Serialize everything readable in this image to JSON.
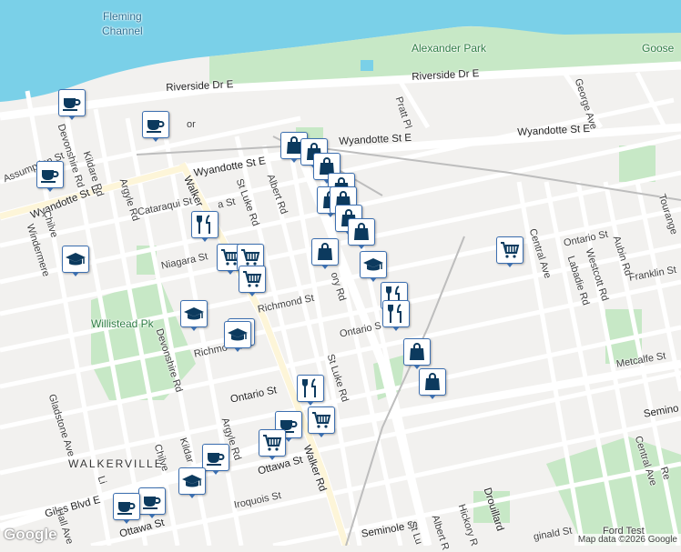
{
  "map": {
    "water_label": "Fleming\nChannel",
    "park_labels": {
      "alexander_park": "Alexander Park",
      "goose": "Goose",
      "willistead_pk": "Willistead Pk"
    },
    "area_label": "WALKERVILLE",
    "roads": {
      "riverside": "Riverside Dr E",
      "wyandotte_e1": "Wyandotte St E",
      "wyandotte_e2": "Wyandotte St E",
      "wyandotte_e3": "Wyandotte St E",
      "assumption": "Assumption St",
      "devonshire_top": "Devonshire Rd",
      "kildare_top": "Kildare Rd",
      "argyle_top": "Argyle Rd",
      "cataraqui": "Cataraqui St",
      "walker_top": "Walker",
      "lincoln_top": "a St",
      "st_luke_top": "St Luke Rd",
      "albert_top": "Albert Rd",
      "pratt": "Pratt Pl",
      "george": "George Ave",
      "franklin": "Franklin St",
      "ontario_right": "Ontario St",
      "westcott": "Westcott Rd",
      "aubin": "Aubin Rd",
      "labadie": "Labadie Rd",
      "central": "Central Ave",
      "central_low": "Central Ave",
      "tourangeau": "Tourange",
      "niagara": "Niagara St",
      "richmond": "Richmond St",
      "richmond_left": "Richmo",
      "devonshire_mid": "Devonshire Rd",
      "chilver_top": "Chilve",
      "windermere": "Windermere",
      "hickory_top": "ory Rd",
      "ontario_mid": "Ontario S",
      "metcalfe": "Metcalfe St",
      "st_luke_mid": "St Luke Rd",
      "ontario_low": "Ontario St",
      "gladstone": "Gladstone Ave",
      "argyle_low": "Argyle Rd",
      "kildare_low": "Kildar",
      "chilver_low": "Chilve",
      "walker_low": "Walker Rd",
      "ottawa": "Ottawa St",
      "ottawa_low": "Ottawa St",
      "iroquois": "Iroquois St",
      "giles": "Giles Blvd E",
      "hall": "Hall Ave",
      "lincoln_low": "Li",
      "seminole": "Seminole St",
      "seminole_right": "Semino",
      "st_luke_low": "St Lu",
      "albert_low": "Albert R",
      "hickory_low": "Hickory R",
      "drouillard": "Drouillard",
      "reginald": "ginald St",
      "central_right": "Central Ave",
      "re": "Re",
      "ford_test": "Ford Test"
    },
    "transit_label": "or"
  },
  "markers": [
    {
      "type": "coffee"
    },
    {
      "type": "coffee"
    },
    {
      "type": "coffee"
    },
    {
      "type": "school"
    },
    {
      "type": "shop"
    },
    {
      "type": "shop"
    },
    {
      "type": "shop"
    },
    {
      "type": "shop"
    },
    {
      "type": "shop"
    },
    {
      "type": "shop"
    },
    {
      "type": "shop"
    },
    {
      "type": "shop"
    },
    {
      "type": "restaurant"
    },
    {
      "type": "cart"
    },
    {
      "type": "cart"
    },
    {
      "type": "cart"
    },
    {
      "type": "shop"
    },
    {
      "type": "school"
    },
    {
      "type": "restaurant"
    },
    {
      "type": "restaurant"
    },
    {
      "type": "cart"
    },
    {
      "type": "school"
    },
    {
      "type": "school"
    },
    {
      "type": "shop"
    },
    {
      "type": "shop"
    },
    {
      "type": "restaurant"
    },
    {
      "type": "coffee"
    },
    {
      "type": "cart"
    },
    {
      "type": "cart"
    },
    {
      "type": "coffee"
    },
    {
      "type": "school"
    },
    {
      "type": "coffee"
    },
    {
      "type": "coffee"
    }
  ],
  "branding": {
    "logo": "Google",
    "attribution": "Map data ©2026 Google"
  },
  "colors": {
    "water": "#7ad0e8",
    "park": "#c7e8c6",
    "road": "#ffffff",
    "background": "#f2f1ef",
    "marker_border": "#3c6fb0",
    "marker_icon": "#0c3a5e"
  }
}
